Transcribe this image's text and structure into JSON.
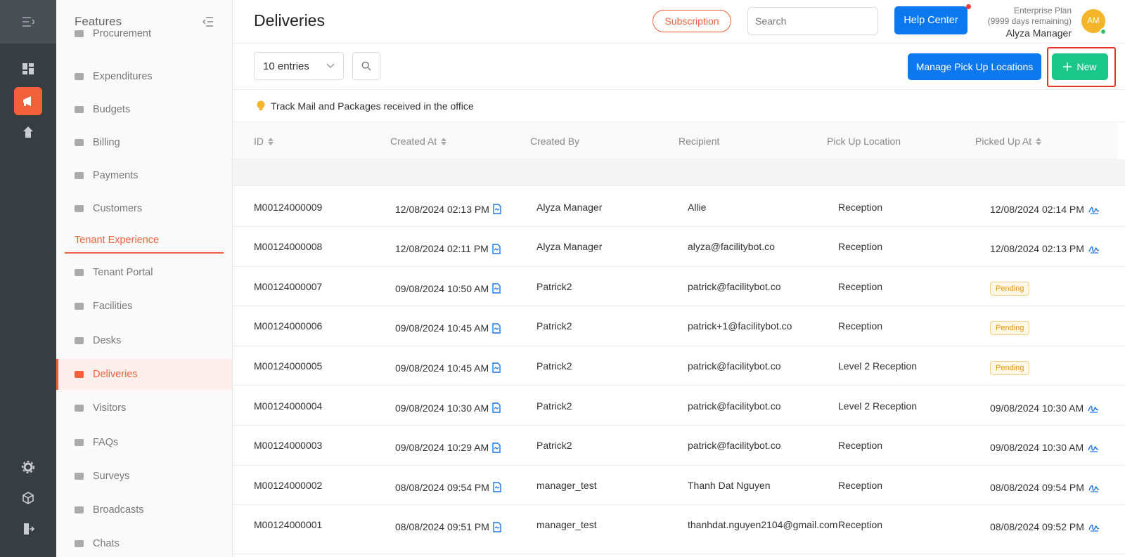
{
  "app": {
    "sidebar_title": "Features",
    "page_title": "Deliveries"
  },
  "sidebar": {
    "items": [
      {
        "label": "Procurement",
        "icon": "cart-icon"
      },
      {
        "label": "Expenditures",
        "icon": "wallet-icon"
      },
      {
        "label": "Budgets",
        "icon": "calculator-icon"
      },
      {
        "label": "Billing",
        "icon": "invoice-icon"
      },
      {
        "label": "Payments",
        "icon": "payment-icon"
      },
      {
        "label": "Customers",
        "icon": "people-icon"
      }
    ],
    "section_label": "Tenant Experience",
    "section_items": [
      {
        "label": "Tenant Portal",
        "icon": "home-icon"
      },
      {
        "label": "Facilities",
        "icon": "calendar-icon"
      },
      {
        "label": "Desks",
        "icon": "desk-icon"
      },
      {
        "label": "Deliveries",
        "icon": "truck-icon",
        "active": true
      },
      {
        "label": "Visitors",
        "icon": "visitor-icon"
      },
      {
        "label": "FAQs",
        "icon": "info-icon"
      },
      {
        "label": "Surveys",
        "icon": "list-icon"
      },
      {
        "label": "Broadcasts",
        "icon": "megaphone-icon"
      },
      {
        "label": "Chats",
        "icon": "chat-icon"
      }
    ]
  },
  "header": {
    "subscription_label": "Subscription",
    "search_placeholder": "Search",
    "help_label": "Help Center",
    "plan_name": "Enterprise Plan",
    "plan_remaining": "(9999 days remaining)",
    "user_name": "Alyza Manager",
    "avatar_initials": "AM"
  },
  "toolbar": {
    "entries_value": "10 entries",
    "manage_label": "Manage Pick Up Locations",
    "new_label": "New"
  },
  "tip": "Track Mail and Packages received in the office",
  "table": {
    "headers": [
      "ID",
      "Created At",
      "Created By",
      "Recipient",
      "Pick Up Location",
      "Picked Up At"
    ],
    "rows": [
      {
        "id": "M00124000009",
        "created_at": "12/08/2024 02:13 PM",
        "created_by": "Alyza Manager",
        "recipient": "Allie",
        "location": "Reception",
        "picked": "12/08/2024 02:14 PM",
        "pending": false
      },
      {
        "id": "M00124000008",
        "created_at": "12/08/2024 02:11 PM",
        "created_by": "Alyza Manager",
        "recipient": "alyza@facilitybot.co",
        "location": "Reception",
        "picked": "12/08/2024 02:13 PM",
        "pending": false
      },
      {
        "id": "M00124000007",
        "created_at": "09/08/2024 10:50 AM",
        "created_by": "Patrick2",
        "recipient": "patrick@facilitybot.co",
        "location": "Reception",
        "picked": "Pending",
        "pending": true
      },
      {
        "id": "M00124000006",
        "created_at": "09/08/2024 10:45 AM",
        "created_by": "Patrick2",
        "recipient": "patrick+1@facilitybot.co",
        "location": "Reception",
        "picked": "Pending",
        "pending": true
      },
      {
        "id": "M00124000005",
        "created_at": "09/08/2024 10:45 AM",
        "created_by": "Patrick2",
        "recipient": "patrick@facilitybot.co",
        "location": "Level 2 Reception",
        "picked": "Pending",
        "pending": true
      },
      {
        "id": "M00124000004",
        "created_at": "09/08/2024 10:30 AM",
        "created_by": "Patrick2",
        "recipient": "patrick@facilitybot.co",
        "location": "Level 2 Reception",
        "picked": "09/08/2024 10:30 AM",
        "pending": false
      },
      {
        "id": "M00124000003",
        "created_at": "09/08/2024 10:29 AM",
        "created_by": "Patrick2",
        "recipient": "patrick@facilitybot.co",
        "location": "Reception",
        "picked": "09/08/2024 10:30 AM",
        "pending": false
      },
      {
        "id": "M00124000002",
        "created_at": "08/08/2024 09:54 PM",
        "created_by": "manager_test",
        "recipient": "Thanh Dat Nguyen",
        "location": "Reception",
        "picked": "08/08/2024 09:54 PM",
        "pending": false
      },
      {
        "id": "M00124000001",
        "created_at": "08/08/2024 09:51 PM",
        "created_by": "manager_test",
        "recipient": "thanhdat.nguyen2104@gmail.com",
        "location": "Reception",
        "picked": "08/08/2024 09:52 PM",
        "pending": false
      }
    ]
  },
  "colors": {
    "accent": "#f2603a",
    "primary": "#0b78f0",
    "success": "#1cc78c"
  }
}
